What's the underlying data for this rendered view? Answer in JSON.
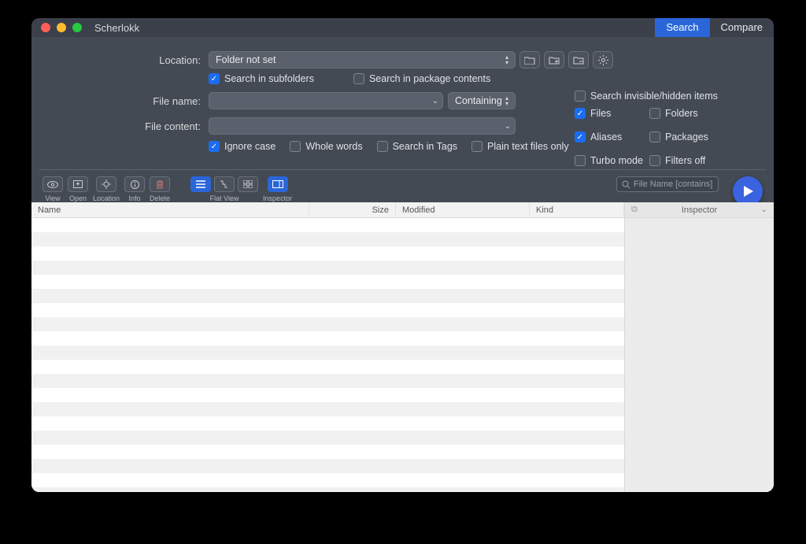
{
  "app": {
    "title": "Scherlokk"
  },
  "tabs": {
    "search": "Search",
    "compare": "Compare",
    "active": "search"
  },
  "labels": {
    "location": "Location:",
    "filename": "File name:",
    "filecontent": "File content:"
  },
  "location": {
    "value": "Folder not set",
    "subfolders": "Search in subfolders",
    "package_contents": "Search in package contents"
  },
  "filename": {
    "value": "",
    "match_mode": "Containing"
  },
  "filecontent": {
    "value": ""
  },
  "content_opts": {
    "ignore_case": "Ignore case",
    "whole_words": "Whole words",
    "search_tags": "Search in Tags",
    "plain_text_only": "Plain text files only"
  },
  "side_opts": {
    "invisible": "Search invisible/hidden items",
    "files": "Files",
    "folders": "Folders",
    "aliases": "Aliases",
    "packages": "Packages",
    "turbo": "Turbo mode",
    "filters_off": "Filters off"
  },
  "checks": {
    "subfolders": true,
    "package_contents": false,
    "ignore_case": true,
    "whole_words": false,
    "search_tags": false,
    "plain_text_only": false,
    "invisible": false,
    "files": true,
    "folders": false,
    "aliases": true,
    "packages": false,
    "turbo": false,
    "filters_off": false
  },
  "toolbar": {
    "view": "View",
    "open": "Open",
    "location": "Location",
    "info": "Info",
    "delete": "Delete",
    "flat_view": "Flat View",
    "inspector": "Inspector",
    "search_placeholder": "File Name [contains]"
  },
  "columns": {
    "name": "Name",
    "size": "Size",
    "modified": "Modified",
    "kind": "Kind"
  },
  "inspector": {
    "title": "Inspector"
  }
}
